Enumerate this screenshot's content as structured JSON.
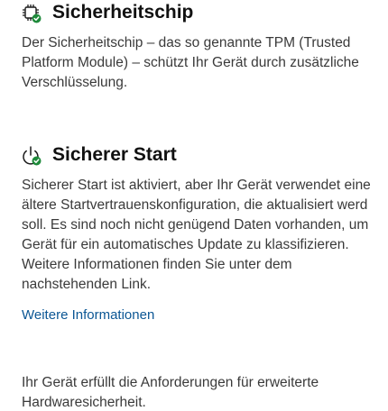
{
  "security_chip": {
    "icon": "chip-check-icon",
    "title": "Sicherheitschip",
    "description_lines": [
      "Der Sicherheitschip – das so genannte TPM (Trusted",
      "Platform Module) – schützt Ihr Gerät durch zusätzliche",
      "Verschlüsselung."
    ]
  },
  "secure_boot": {
    "icon": "secure-boot-check-icon",
    "title": "Sicherer Start",
    "description_lines": [
      "Sicherer Start ist aktiviert, aber Ihr Gerät verwendet eine",
      "ältere Startvertrauenskonfiguration, die aktualisiert werd",
      "soll. Es sind noch nicht genügend Daten vorhanden, um",
      "Gerät für ein automatisches Update zu klassifizieren.",
      "Weitere Informationen finden Sie unter dem",
      "nachstehenden Link."
    ],
    "link_label": "Weitere Informationen"
  },
  "requirements": {
    "description_lines": [
      "Ihr Gerät erfüllt die Anforderungen für erweiterte",
      "Hardwaresicherheit."
    ]
  },
  "colors": {
    "check_green": "#1f8a3b",
    "link_blue": "#0b5694"
  }
}
